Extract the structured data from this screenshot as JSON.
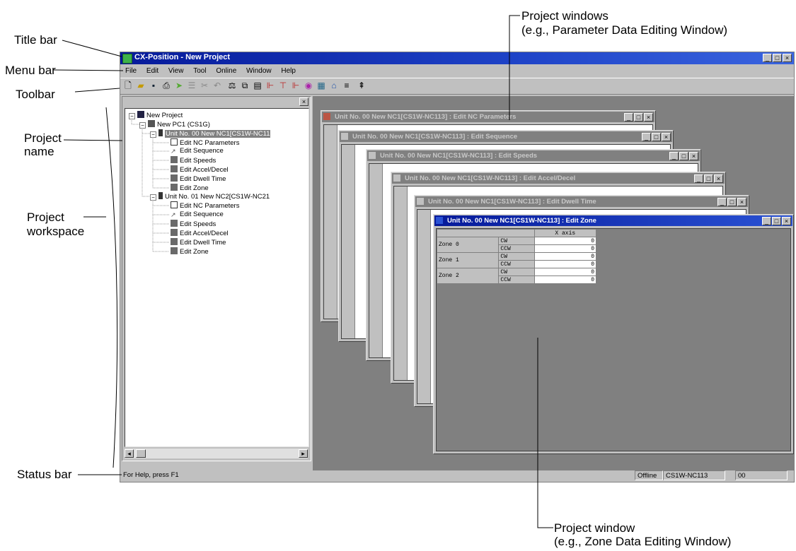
{
  "callouts": {
    "title_bar": "Title bar",
    "menu_bar": "Menu bar",
    "toolbar": "Toolbar",
    "project_name_1": "Project",
    "project_name_2": "name",
    "project_workspace_1": "Project",
    "project_workspace_2": "workspace",
    "status_bar": "Status bar",
    "project_windows_1": "Project windows",
    "project_windows_2": "(e.g., Parameter Data Editing Window)",
    "project_window_1": "Project window",
    "project_window_2": "(e.g., Zone Data Editing Window)"
  },
  "window": {
    "title": "CX-Position - New Project",
    "buttons": [
      "_",
      "□",
      "×"
    ]
  },
  "menu": [
    "File",
    "Edit",
    "View",
    "Tool",
    "Online",
    "Window",
    "Help"
  ],
  "toolbar_icons": [
    "new-icon",
    "open-icon",
    "save-icon",
    "print-icon",
    "transfer-icon",
    "properties-icon",
    "cut-icon",
    "undo-icon",
    "compare-icon",
    "copy-icon",
    "paste-icon",
    "download-icon",
    "upload-icon",
    "monitor-icon",
    "test-icon",
    "zone-icon",
    "home-icon",
    "list-icon",
    "help-icon"
  ],
  "tree": {
    "root": "New Project",
    "plc": "New PC1 (CS1G)",
    "unit0": "Unit No. 00 New NC1[CS1W-NC11",
    "unit0_items": [
      "Edit NC Parameters",
      "Edit Sequence",
      "Edit Speeds",
      "Edit Accel/Decel",
      "Edit Dwell Time",
      "Edit Zone"
    ],
    "unit1": "Unit No. 01 New NC2[CS1W-NC21",
    "unit1_items": [
      "Edit NC Parameters",
      "Edit Sequence",
      "Edit Speeds",
      "Edit Accel/Decel",
      "Edit Dwell Time",
      "Edit Zone"
    ]
  },
  "child_windows": [
    {
      "title": "Unit No. 00 New NC1[CS1W-NC113] : Edit NC Parameters"
    },
    {
      "title": "Unit No. 00 New NC1[CS1W-NC113] : Edit Sequence"
    },
    {
      "title": "Unit No. 00 New NC1[CS1W-NC113] : Edit Speeds"
    },
    {
      "title": "Unit No. 00 New NC1[CS1W-NC113] : Edit Accel/Decel"
    },
    {
      "title": "Unit No. 00 New NC1[CS1W-NC113] : Edit Dwell Time"
    },
    {
      "title": "Unit No. 00 New NC1[CS1W-NC113] : Edit Zone"
    }
  ],
  "zone_table": {
    "header": "X axis",
    "rows": [
      {
        "zone": "Zone 0",
        "dir": "CW",
        "value": "0"
      },
      {
        "zone": "",
        "dir": "CCW",
        "value": "0"
      },
      {
        "zone": "Zone 1",
        "dir": "CW",
        "value": "0"
      },
      {
        "zone": "",
        "dir": "CCW",
        "value": "0"
      },
      {
        "zone": "Zone 2",
        "dir": "CW",
        "value": "0"
      },
      {
        "zone": "",
        "dir": "CCW",
        "value": "0"
      }
    ]
  },
  "status": {
    "help": "For Help, press F1",
    "mode": "Offline",
    "unit": "CS1W-NC113",
    "num": "00"
  }
}
